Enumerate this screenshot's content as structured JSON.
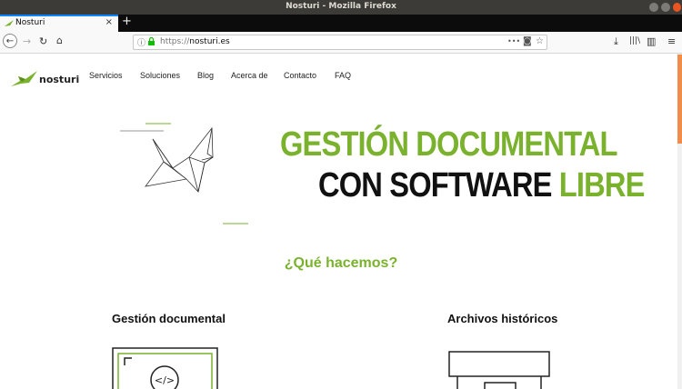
{
  "window": {
    "title": "Nosturi - Mozilla Firefox"
  },
  "tab": {
    "label": "Nosturi",
    "close": "×",
    "new_tab": "+"
  },
  "toolbar": {
    "back": "←",
    "forward": "→",
    "reload": "↻",
    "home": "⌂",
    "url_scheme": "https://",
    "url_host": "nosturi.es",
    "info_icon": "ⓘ",
    "lock_icon": "🔒",
    "page_actions": "•••",
    "pocket": "◙",
    "bookmark": "☆",
    "download": "⤓",
    "library": "|||\\",
    "sidebar": "▥",
    "menu": "≡"
  },
  "site": {
    "logo_text": "nosturi",
    "nav": [
      "Servicios",
      "Soluciones",
      "Blog",
      "Acerca de",
      "Contacto",
      "FAQ"
    ],
    "hero": {
      "line1": "GESTIÓN DOCUMENTAL",
      "line2_black": "CON SOFTWARE",
      "line2_green": "LIBRE"
    },
    "section_title": "¿Qué hacemos?",
    "features": [
      "Gestión documental",
      "Archivos históricos"
    ],
    "doc_icon_glyph": "</>"
  },
  "colors": {
    "brand_green": "#7ab22e",
    "scroll_thumb": "#f28c4a",
    "titlebar": "#3c3b37"
  }
}
